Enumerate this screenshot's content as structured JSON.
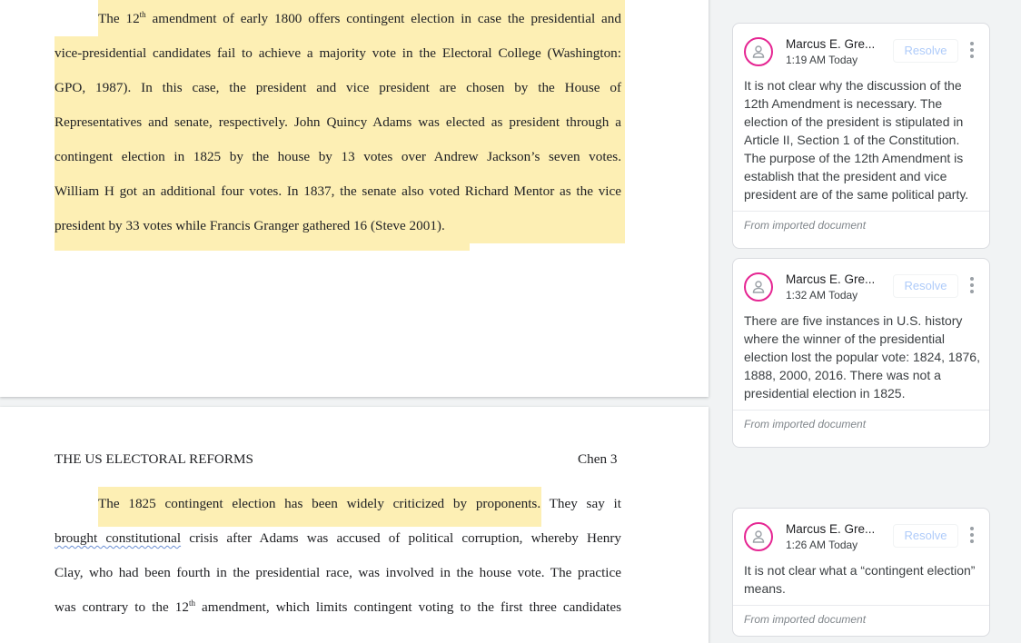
{
  "document": {
    "page1_lines": [
      {
        "pre": "The 12",
        "sup": "th",
        "post": " amendment of early 1800 offers contingent election in case the presidential and"
      },
      {
        "text": "vice-presidential candidates fail to achieve a majority vote in the Electoral College (Washington:"
      },
      {
        "text": "GPO, 1987). In this case, the president and vice president are chosen by the House of"
      },
      {
        "text": "Representatives and senate, respectively. John Quincy Adams was elected as president through a"
      },
      {
        "text": "contingent election in 1825 by the house by 13 votes over Andrew Jackson’s seven votes."
      },
      {
        "text": "William H got an additional four votes. In 1837, the senate also voted Richard Mentor as the vice"
      },
      {
        "text": "president by 33 votes while Francis Granger gathered 16 (Steve 2001)."
      }
    ],
    "page2_header_title": "THE US ELECTORAL REFORMS",
    "page2_header_page": "Chen 3",
    "page2_lines": [
      {
        "highlighted": "The 1825 contingent election has been widely criticized by proponents",
        "rest": ". They say it"
      },
      {
        "spell": "brought constitutional",
        "rest": " crisis after Adams was accused of political corruption, whereby Henry"
      },
      {
        "text": "Clay, who had been fourth in the presidential race, was involved in the house vote.  The practice"
      },
      {
        "pre": "was contrary to the 12",
        "sup": "th",
        "post": " amendment, which limits contingent voting to the first three candidates"
      }
    ]
  },
  "comments": [
    {
      "author": "Marcus E. Gre...",
      "time": "1:19 AM Today",
      "resolve_label": "Resolve",
      "body": "It is not clear why the discussion of the 12th Amendment is necessary. The election of the president is stipulated in Article II, Section 1 of the Constitution. The purpose of the 12th Amendment is establish that the president and vice president are of the same political party.",
      "source": "From imported document"
    },
    {
      "author": "Marcus E. Gre...",
      "time": "1:32 AM Today",
      "resolve_label": "Resolve",
      "body": "There are five instances in U.S. history where the winner of the presidential election lost the popular vote: 1824, 1876, 1888, 2000, 2016. There was not a presidential election in 1825.",
      "source": "From imported document"
    },
    {
      "author": "Marcus E. Gre...",
      "time": "1:26 AM Today",
      "resolve_label": "Resolve",
      "body": "It is not clear what a “contingent election” means.",
      "source": "From imported document"
    }
  ],
  "colors": {
    "highlight": "#fdefb4",
    "avatar_ring": "#e52592",
    "resolve_text": "#aecbfa"
  },
  "icons": [
    "account-avatar-icon",
    "more-vert-icon"
  ]
}
